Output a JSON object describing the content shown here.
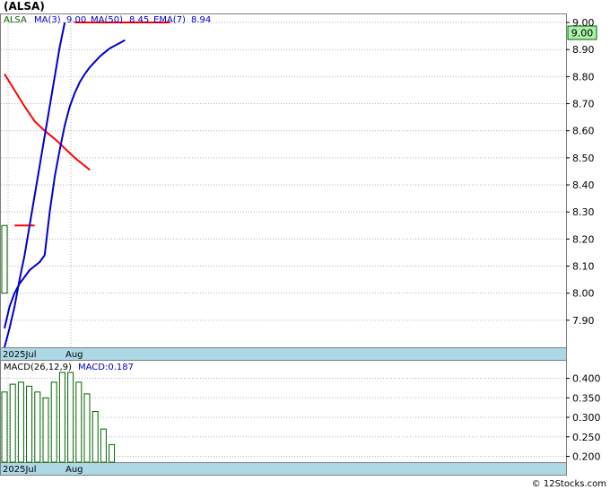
{
  "ticker_title": "(ALSA)",
  "legend": {
    "symbol": "ALSA",
    "ma3_label": "MA(3)",
    "ma3_value": "9.00",
    "ma50_label": "MA(50)",
    "ma50_value": "8.45",
    "ema7_label": "EMA(7)",
    "ema7_value": "8.94"
  },
  "price_badge": "9.00",
  "macd_legend": {
    "label": "MACD(26,12,9)",
    "value_label": "MACD:0.187"
  },
  "footer": "© 12Stocks.com",
  "colors": {
    "candle": "#006400",
    "ma3": "#000000",
    "ma50": "#ff0000",
    "ema7": "#0000cc",
    "axis_band": "#add8e6",
    "grid": "#b4b4b4",
    "badge_bg": "#aaf0aa"
  },
  "chart_data": [
    {
      "type": "line",
      "name": "price",
      "x_tick_labels": [
        "2025Jul",
        "Aug"
      ],
      "y_ticks": [
        "9.00",
        "8.90",
        "8.80",
        "8.70",
        "8.60",
        "8.50",
        "8.40",
        "8.30",
        "8.20",
        "8.10",
        "8.00",
        "7.90"
      ],
      "ylim": [
        7.8,
        9.03
      ],
      "grid": true,
      "bars": [
        {
          "x": 0,
          "open": 8.25,
          "close": 8.0,
          "high": 8.25,
          "low": 8.0
        }
      ],
      "series": [
        {
          "name": "MA(3)",
          "points": [
            [
              14,
              9.0
            ],
            [
              28,
              9.0
            ]
          ]
        },
        {
          "name": "MA(50)",
          "points": [
            [
              0,
              8.81
            ],
            [
              2,
              8.75
            ],
            [
              4,
              8.69
            ],
            [
              6,
              8.635
            ],
            [
              8,
              8.6
            ],
            [
              10,
              8.57
            ],
            [
              12,
              8.535
            ],
            [
              14,
              8.5
            ],
            [
              16,
              8.47
            ],
            [
              17,
              8.455
            ]
          ]
        },
        {
          "name": "MA(50)",
          "points": [
            [
              2,
              8.25
            ],
            [
              6,
              8.25
            ]
          ]
        },
        {
          "name": "MA(50)",
          "points": [
            [
              14,
              9.0
            ],
            [
              17,
              9.0
            ],
            [
              20,
              9.0
            ],
            [
              28,
              9.0
            ],
            [
              33,
              9.0
            ]
          ]
        },
        {
          "name": "EMA(7)",
          "points": [
            [
              0,
              7.87
            ],
            [
              1,
              7.95
            ],
            [
              2,
              8.0
            ],
            [
              3,
              8.035
            ],
            [
              4,
              8.06
            ],
            [
              5,
              8.085
            ],
            [
              6,
              8.1
            ],
            [
              7,
              8.115
            ],
            [
              8,
              8.14
            ],
            [
              9,
              8.3
            ],
            [
              10,
              8.43
            ],
            [
              11,
              8.53
            ],
            [
              12,
              8.62
            ],
            [
              13,
              8.69
            ],
            [
              14,
              8.74
            ],
            [
              15,
              8.78
            ],
            [
              16,
              8.81
            ],
            [
              17,
              8.835
            ],
            [
              18,
              8.855
            ],
            [
              19,
              8.875
            ],
            [
              20,
              8.89
            ],
            [
              21,
              8.905
            ],
            [
              22,
              8.915
            ],
            [
              23,
              8.925
            ],
            [
              24,
              8.935
            ]
          ]
        },
        {
          "name": "EMA(7)",
          "points": [
            [
              0,
              7.8
            ],
            [
              1,
              7.87
            ],
            [
              2,
              7.95
            ],
            [
              3,
              8.05
            ],
            [
              4,
              8.14
            ],
            [
              5,
              8.25
            ],
            [
              6,
              8.36
            ],
            [
              7,
              8.47
            ],
            [
              8,
              8.58
            ],
            [
              9,
              8.69
            ],
            [
              10,
              8.8
            ],
            [
              11,
              8.91
            ],
            [
              12,
              9.0
            ]
          ]
        }
      ]
    },
    {
      "type": "bar",
      "name": "MACD",
      "x_tick_labels": [
        "2025Jul",
        "Aug"
      ],
      "y_ticks": [
        "0.400",
        "0.350",
        "0.300",
        "0.250",
        "0.200"
      ],
      "ylim": [
        0.185,
        0.445
      ],
      "grid": true,
      "values": [
        0.365,
        0.385,
        0.39,
        0.38,
        0.365,
        0.35,
        0.39,
        0.415,
        0.415,
        0.39,
        0.36,
        0.315,
        0.27,
        0.23
      ]
    }
  ]
}
